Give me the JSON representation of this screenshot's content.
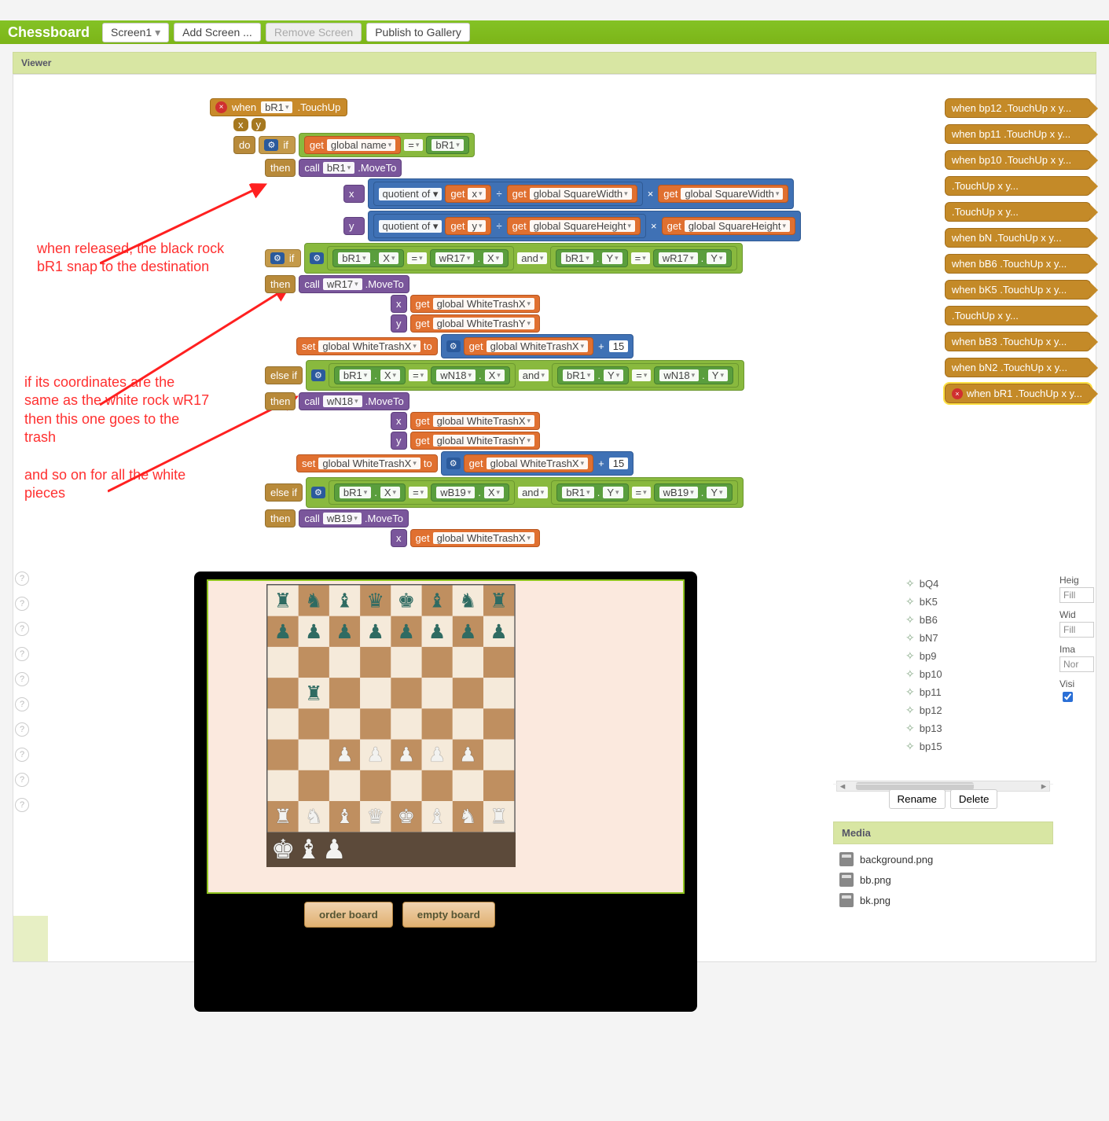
{
  "toolbar": {
    "title": "Chessboard",
    "screen": "Screen1",
    "add": "Add Screen ...",
    "remove": "Remove Screen",
    "publish": "Publish to Gallery"
  },
  "viewer": {
    "title": "Viewer"
  },
  "annot": {
    "a1": "when released, the black rock bR1 snap to the destination",
    "a2": "if its coordinates are the same as the white rock wR17 then this one goes to the trash",
    "a3": "and so on for all the white pieces"
  },
  "blocks": {
    "when": "when",
    "touchup": ".TouchUp",
    "br1": "bR1",
    "x": "x",
    "y": "y",
    "do": "do",
    "if": "if",
    "then": "then",
    "elseif": "else if",
    "get": "get",
    "set": "set",
    "to": "to",
    "call": "call",
    "moveto": ".MoveTo",
    "globalname": "global name",
    "eq": "=",
    "and": "and",
    "quotient": "quotient of ▾",
    "div": "÷",
    "squareW": "global SquareWidth",
    "squareH": "global SquareHeight",
    "wr17": "wR17",
    "wn18": "wN18",
    "wb19": "wB19",
    "dotX": "X",
    "dotY": "Y",
    "whiteTrashX": "global WhiteTrashX",
    "whiteTrashY": "global WhiteTrashY",
    "plus": "+",
    "fifteen": "15",
    "times": "×"
  },
  "pills": [
    {
      "t": "when  bp12 .TouchUp   x   y..."
    },
    {
      "t": "when  bp11 .TouchUp   x   y..."
    },
    {
      "t": "when  bp10 .TouchUp   x   y..."
    },
    {
      "t": ".TouchUp   x   y..."
    },
    {
      "t": ".TouchUp   x   y..."
    },
    {
      "t": "when  bN .TouchUp   x   y..."
    },
    {
      "t": "when  bB6 .TouchUp   x   y..."
    },
    {
      "t": "when  bK5 .TouchUp   x   y..."
    },
    {
      "t": ".TouchUp   x   y..."
    },
    {
      "t": "when  bB3 .TouchUp   x   y..."
    },
    {
      "t": "when  bN2 .TouchUp   x   y..."
    },
    {
      "t": "when  bR1 .TouchUp   x   y...",
      "sel": true
    }
  ],
  "phone": {
    "btn1": "order board",
    "btn2": "empty board"
  },
  "components": {
    "items": [
      "bQ4",
      "bK5",
      "bB6",
      "bN7",
      "bp9",
      "bp10",
      "bp11",
      "bp12",
      "bp13",
      "bp15"
    ],
    "rename": "Rename",
    "delete": "Delete"
  },
  "media": {
    "title": "Media",
    "items": [
      "background.png",
      "bb.png",
      "bk.png"
    ]
  },
  "props": {
    "height_lbl": "Heig",
    "height_v": "Fill",
    "width_lbl": "Wid",
    "width_v": "Fill",
    "image_lbl": "Ima",
    "image_v": "Nor",
    "visible_lbl": "Visi",
    "visible_v": true
  },
  "chess": {
    "layout": [
      [
        "br",
        "bn",
        "bb",
        "bq",
        "bk",
        "bb",
        "bn",
        "br"
      ],
      [
        "bp",
        "bp",
        "bp",
        "bp",
        "bp",
        "bp",
        "bp",
        "bp"
      ],
      [
        "",
        "",
        "",
        "",
        "",
        "",
        "",
        ""
      ],
      [
        "",
        "br",
        "",
        "",
        "",
        "",
        "",
        ""
      ],
      [
        "",
        "",
        "",
        "",
        "",
        "",
        "",
        ""
      ],
      [
        "",
        "",
        "wp",
        "wp",
        "wp",
        "wp",
        "wp",
        ""
      ],
      [
        "",
        "",
        "",
        "",
        "",
        "",
        "",
        ""
      ],
      [
        "wr",
        "wn",
        "wb",
        "wq",
        "wk",
        "wb",
        "wn",
        "wr"
      ]
    ],
    "glyph": {
      "r": "♜",
      "n": "♞",
      "b": "♝",
      "q": "♛",
      "k": "♚",
      "p": "♟"
    }
  }
}
